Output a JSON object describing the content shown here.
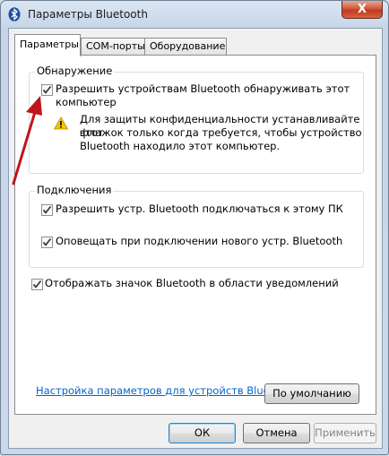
{
  "window": {
    "title": "Параметры Bluetooth",
    "close_glyph": "X"
  },
  "tabs": [
    {
      "label": "Параметры",
      "active": true
    },
    {
      "label": "COM-порты",
      "active": false
    },
    {
      "label": "Оборудование",
      "active": false
    }
  ],
  "discovery": {
    "title": "Обнаружение",
    "allow_discovery": {
      "checked": true,
      "label_line1": "Разрешить устройствам Bluetooth обнаруживать этот",
      "label_line2": "компьютер"
    },
    "warning_line1": "Для защиты конфиденциальности устанавливайте этот",
    "warning_line2": "флажок только когда требуется, чтобы устройство",
    "warning_line3": "Bluetooth находило этот компьютер."
  },
  "connections": {
    "title": "Подключения",
    "allow_connect": {
      "checked": true,
      "label": "Разрешить устр. Bluetooth подключаться к этому ПК"
    },
    "notify_new": {
      "checked": true,
      "label": "Оповещать при подключении нового устр. Bluetooth"
    }
  },
  "show_icon": {
    "checked": true,
    "label": "Отображать значок Bluetooth в области уведомлений"
  },
  "settings_link": "Настройка параметров для устройств Bluetooth.",
  "buttons": {
    "defaults": "По умолчанию",
    "ok": "ОК",
    "cancel": "Отмена",
    "apply": "Применить"
  },
  "colors": {
    "link": "#0066cc",
    "arrow": "#c0141c",
    "warning": "#f5c400"
  }
}
